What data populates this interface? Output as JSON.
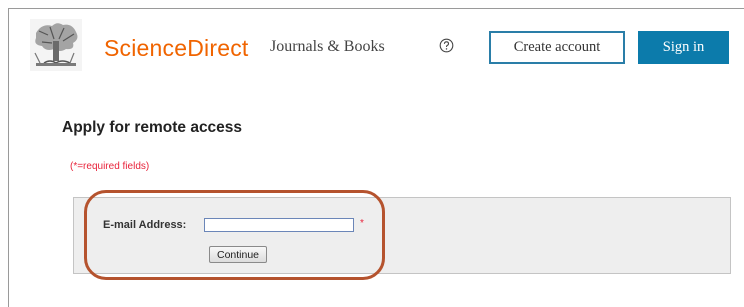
{
  "header": {
    "brand": "ScienceDirect",
    "nav_journals": "Journals & Books",
    "create_account": "Create account",
    "sign_in": "Sign in"
  },
  "icons": {
    "logo": "elsevier-tree-logo",
    "help": "help-circle-icon"
  },
  "main": {
    "heading": "Apply for remote access",
    "required_note": "(*=required fields)",
    "form": {
      "email_label": "E-mail Address:",
      "email_value": "",
      "required_marker": "*",
      "continue_label": "Continue"
    }
  },
  "colors": {
    "brand": "#f06400",
    "primary_button": "#0c7bab",
    "required": "#e8233b",
    "highlight": "#b5532e"
  }
}
